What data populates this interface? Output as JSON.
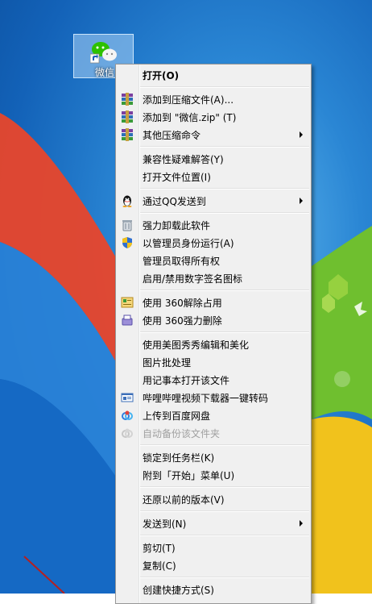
{
  "desktop": {
    "icon_label": "微信"
  },
  "menu": {
    "items": [
      {
        "label": "打开(O)",
        "bold": true
      },
      {
        "label": "添加到压缩文件(A)...",
        "icon": "winrar-archive-icon"
      },
      {
        "label": "添加到 \"微信.zip\" (T)",
        "icon": "winrar-archive-icon"
      },
      {
        "label": "其他压缩命令",
        "icon": "winrar-archive-icon",
        "submenu": true
      },
      {
        "label": "兼容性疑难解答(Y)"
      },
      {
        "label": "打开文件位置(I)"
      },
      {
        "label": "通过QQ发送到",
        "icon": "qq-penguin-icon",
        "submenu": true
      },
      {
        "label": "强力卸载此软件",
        "icon": "trash-bin-icon"
      },
      {
        "label": "以管理员身份运行(A)",
        "icon": "uac-shield-icon"
      },
      {
        "label": "管理员取得所有权"
      },
      {
        "label": "启用/禁用数字签名图标"
      },
      {
        "label": "使用 360解除占用",
        "icon": "360-unlock-icon"
      },
      {
        "label": "使用 360强力删除",
        "icon": "360-shred-icon"
      },
      {
        "label": "使用美图秀秀编辑和美化"
      },
      {
        "label": "图片批处理"
      },
      {
        "label": "用记事本打开该文件"
      },
      {
        "label": "哔哩哔哩视频下载器一键转码",
        "icon": "video-window-icon"
      },
      {
        "label": "上传到百度网盘",
        "icon": "baidu-cloud-icon"
      },
      {
        "label": "自动备份该文件夹",
        "icon": "baidu-cloud-icon",
        "disabled": true
      },
      {
        "label": "锁定到任务栏(K)"
      },
      {
        "label": "附到「开始」菜单(U)"
      },
      {
        "label": "还原以前的版本(V)"
      },
      {
        "label": "发送到(N)",
        "submenu": true
      },
      {
        "label": "剪切(T)"
      },
      {
        "label": "复制(C)"
      },
      {
        "label": "创建快捷方式(S)"
      }
    ]
  }
}
